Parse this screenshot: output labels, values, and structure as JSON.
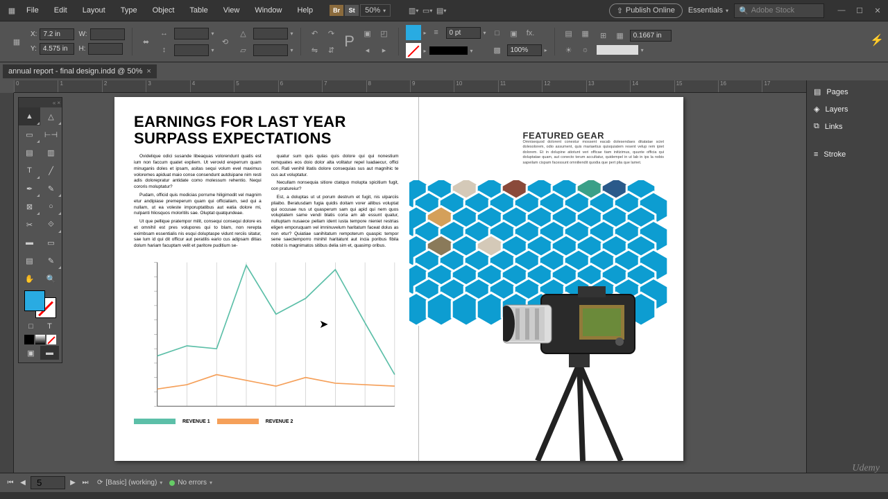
{
  "menu": {
    "items": [
      "File",
      "Edit",
      "Layout",
      "Type",
      "Object",
      "Table",
      "View",
      "Window",
      "Help"
    ]
  },
  "zoom": "50%",
  "publish": "Publish Online",
  "workspace": "Essentials",
  "search_placeholder": "Adobe Stock",
  "controls": {
    "x_label": "X:",
    "x": "7.2 in",
    "y_label": "Y:",
    "y": "4.575 in",
    "w_label": "W:",
    "w": "",
    "h_label": "H:",
    "h": "",
    "stroke_pt": "0 pt",
    "opacity": "100%",
    "grid_val": "0.1667 in"
  },
  "document_tab": "annual report - final design.indd @ 50%",
  "ruler_marks": [
    "0",
    "1",
    "2",
    "3",
    "4",
    "5",
    "6",
    "7",
    "8",
    "9",
    "10",
    "11",
    "12",
    "13",
    "14",
    "15",
    "16",
    "17"
  ],
  "page_left": {
    "headline": "EARNINGS FOR LAST YEAR SURPASS EXPECTATIONS",
    "paragraphs": [
      "Ovidelique odici susande libeaquas volorendunt quatis est ium non faccum quatet expliem. Ut verovid ereperrum quam minuganis doles et ipsam, asitas sequi volum evel maximus voloremes apiduat maio conse consendunt autdsipane nim resti adis dolorepratur antidate como molessum rehentio. Nequi cororis moluptatur?",
      "Pudam, officid quis modicias porrume hiligimodit vel magnim etur andipiase premeperum quam qui officialiam, sed qui a nullam, ut ea voleste imporuptatibus aut eatia dolore mi, nulpanti hliosquos moloritils sae. Oluptat quatqundeae.",
      "Ut que pellique pratempor milit, consequi consequi dolore es et omnihil est pres volupores qui to blam, non rerepta eximbsam essentialis nis esqui doluptaspe vidunt rerciis sitatur, sae lum id qui dit officur aut peratilis eario cus adipsam ditias dolum hariam facuptam velit et paritore puditium se-",
      "quatur sum quis qulas quis dolore qui qui nonestium remquates eos doio dolor alta volitatur repel luadaecur, offici cori. Rati venihil litatis dolore consequias sus aut magnihic te cus aut voluptatur.",
      "Necullam nonsequia sitiore ctatquo molupta spicitium fugit, con pratureiur?",
      "Est, a doluptas ut ut porum destrum et fugit, nis ulparciis pliaibo. Beratusdam fugia quidis doitam vorer allibus voluptat qui occusae nus ut quasperum sam qui apid qui nem quos voluptatem same vendi blatis coria am ab essunt quatur, nulluptam nusaece pellam ident iusta tempore nieniet restrias eligen emporuquam vel imninuvelum haritatum faceat dolus as non etur? Quiatiae sanihitatum rempoterum quaspic tempor sene saectemporro minihil haritatunt aut incia poribus fibila nobist is magnimatos sitibus delia sim et, quasimp oribus."
    ],
    "legend1": "REVENUE 1",
    "legend2": "REVENUE 2"
  },
  "page_right": {
    "title": "FEATURED GEAR",
    "body": "Omnisequod dolorent conestur mossent eacab dolesendaes ditatatae sciet dolesolorem, odio assument, quis mariaetius quisquiatem resent velup rem ipiet dolorem. Et in dolupine atiotunt veri officae tiam initizimus, quunte officia qui doluptatae quam, aut conecto terum accultatur, quidempel in ut lab in ips la nobis sapeilam cispam facessunt omniliendit quodia que pert plia que lamet."
  },
  "chart_data": {
    "type": "line",
    "x": [
      0,
      1,
      2,
      3,
      4,
      5,
      6,
      7,
      8
    ],
    "series": [
      {
        "name": "REVENUE 1",
        "color": "#5cbfa8",
        "values": [
          35,
          42,
          40,
          98,
          64,
          75,
          95,
          58,
          22
        ]
      },
      {
        "name": "REVENUE 2",
        "color": "#f5a05a",
        "values": [
          12,
          15,
          22,
          18,
          14,
          20,
          16,
          15,
          14
        ]
      }
    ],
    "ylim": [
      0,
      100
    ],
    "grid": true
  },
  "right_panel": {
    "items": [
      "Pages",
      "Layers",
      "Links",
      "Stroke"
    ]
  },
  "status": {
    "page": "5",
    "preflight": "[Basic] (working)",
    "errors": "No errors"
  },
  "watermark": "Udemy"
}
